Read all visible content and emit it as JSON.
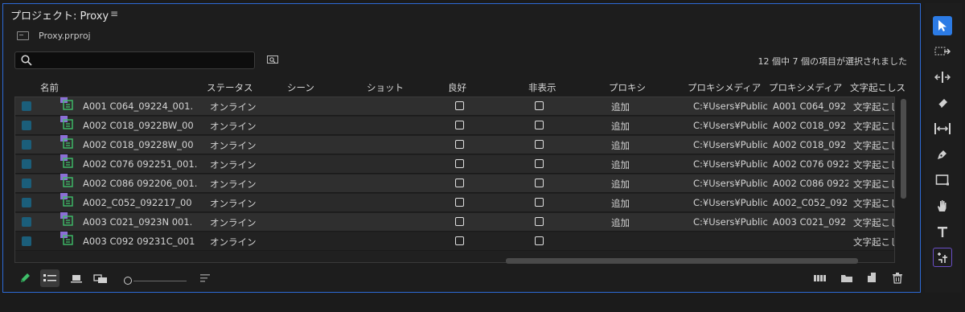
{
  "panel": {
    "title": "プロジェクト: Proxy",
    "menu_icon": "hamburger-menu-icon",
    "bin_name": "Proxy.prproj",
    "search": {
      "value": "",
      "placeholder": ""
    },
    "selection_status": "12 個中 7 個の項目が選択されました"
  },
  "columns": [
    "名前",
    "ステータス",
    "シーン",
    "ショット",
    "良好",
    "非表示",
    "プロキシ",
    "プロキシメディア",
    "プロキシメディア",
    "文字起こしス"
  ],
  "rows": [
    {
      "name": "A001 C064_09224_001.",
      "status": "オンライン",
      "proxy": "追加",
      "proxy_path": "C:¥Users¥Public",
      "proxy_media": "A001 C064_092",
      "transcript": "文字起こし"
    },
    {
      "name": "A002 C018_0922BW_00",
      "status": "オンライン",
      "proxy": "追加",
      "proxy_path": "C:¥Users¥Public",
      "proxy_media": "A002 C018_092",
      "transcript": "文字起こし"
    },
    {
      "name": "A002 C018_09228W_00",
      "status": "オンライン",
      "proxy": "追加",
      "proxy_path": "C:¥Users¥Public",
      "proxy_media": "A002 C018_092",
      "transcript": "文字起こし"
    },
    {
      "name": "A002 C076 092251_001.",
      "status": "オンライン",
      "proxy": "追加",
      "proxy_path": "C:¥Users¥Public",
      "proxy_media": "A002 C076 0922",
      "transcript": "文字起こし"
    },
    {
      "name": "A002 C086 092206_001.",
      "status": "オンライン",
      "proxy": "追加",
      "proxy_path": "C:¥Users¥Public",
      "proxy_media": "A002 C086 0922",
      "transcript": "文字起こし"
    },
    {
      "name": "A002_C052_092217_00",
      "status": "オンライン",
      "proxy": "追加",
      "proxy_path": "C:¥Users¥Public",
      "proxy_media": "A002_C052_092",
      "transcript": "文字起こし"
    },
    {
      "name": "A003 C021_0923N 001.",
      "status": "オンライン",
      "proxy": "追加",
      "proxy_path": "C:¥Users¥Public",
      "proxy_media": "A003 C021_092",
      "transcript": "文字起こし"
    },
    {
      "name": "A003 C092 09231C_001",
      "status": "オンライン",
      "proxy": "",
      "proxy_path": "",
      "proxy_media": "",
      "transcript": "文字起こし"
    }
  ],
  "footer": {
    "icons": [
      "pencil-icon",
      "list-view-icon",
      "icon-view-icon",
      "freeform-view-icon",
      "zoom-slider",
      "sort-icon",
      "automate-to-sequence-icon",
      "new-bin-icon",
      "new-item-icon",
      "trash-icon"
    ]
  },
  "tools": [
    "selection-tool",
    "track-select-tool",
    "ripple-edit-tool",
    "razor-tool",
    "slip-tool",
    "pen-tool",
    "rectangle-tool",
    "hand-tool",
    "type-tool",
    "extract-tool"
  ],
  "colors": {
    "accent": "#2c7be5",
    "label": "#1b5e7a",
    "clip_icon": "#8b6fd6"
  }
}
